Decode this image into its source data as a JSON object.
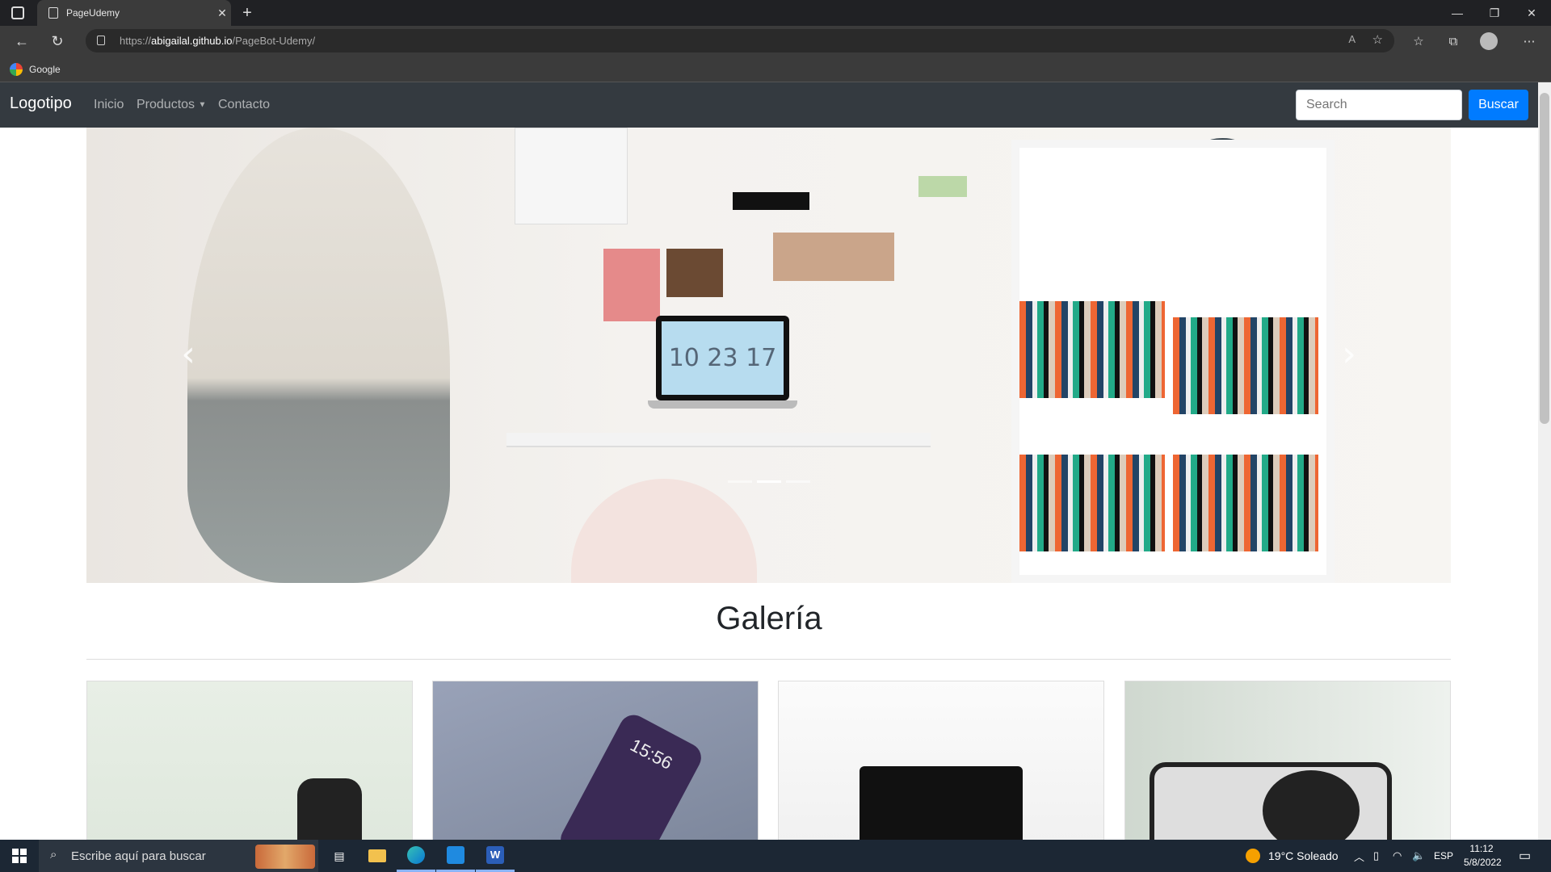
{
  "browser": {
    "tab_title": "PageUdemy",
    "url_scheme": "https://",
    "url_host": "abigailal.github.io",
    "url_path": "/PageBot-Udemy/",
    "favorites": [
      {
        "label": "Google"
      }
    ]
  },
  "navbar": {
    "brand": "Logotipo",
    "links": [
      "Inicio",
      "Productos",
      "Contacto"
    ],
    "search_placeholder": "Search",
    "search_button": "Buscar"
  },
  "carousel": {
    "clock_text": "10 23 17",
    "slide_count": 3,
    "active_index": 1
  },
  "gallery": {
    "title": "Galería",
    "phone_time": "15:56"
  },
  "taskbar": {
    "search_placeholder": "Escribe aquí para buscar",
    "weather": "19°C  Soleado",
    "language": "ESP",
    "time": "11:12",
    "date": "5/8/2022"
  },
  "colors": {
    "navbar_bg": "#343a40",
    "primary_button": "#007bff",
    "taskbar_bg": "#1c2734"
  }
}
